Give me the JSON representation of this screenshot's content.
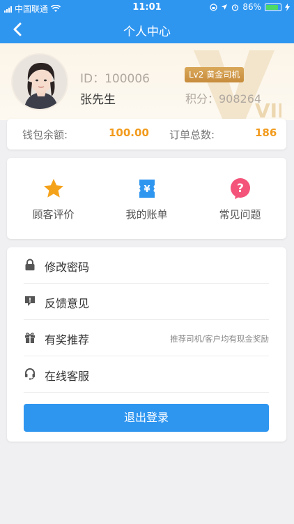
{
  "status_bar": {
    "carrier": "中国联通",
    "time": "11:01",
    "battery": "86%"
  },
  "nav": {
    "title": "个人中心"
  },
  "profile": {
    "id_text": "ID：100006",
    "name": "张先生",
    "level_badge": "Lv2 黄金司机",
    "points_text": "积分：908264",
    "vip_text": "VIP"
  },
  "stats": {
    "wallet_label": "钱包余额:",
    "wallet_value": "100.00",
    "orders_label": "订单总数:",
    "orders_value": "186"
  },
  "quick_actions": [
    {
      "label": "顾客评价",
      "icon": "star-icon"
    },
    {
      "label": "我的账单",
      "icon": "bill-icon"
    },
    {
      "label": "常见问题",
      "icon": "question-icon"
    }
  ],
  "menu": [
    {
      "label": "修改密码",
      "icon": "lock-icon",
      "note": ""
    },
    {
      "label": "反馈意见",
      "icon": "feedback-icon",
      "note": ""
    },
    {
      "label": "有奖推荐",
      "icon": "gift-icon",
      "note": "推荐司机/客户均有现金奖励"
    },
    {
      "label": "在线客服",
      "icon": "headset-icon",
      "note": ""
    }
  ],
  "logout_label": "退出登录",
  "colors": {
    "primary": "#2f96f0",
    "accent": "#f29b1d",
    "star": "#f5a21b",
    "question": "#f4547a",
    "badge": "#d9a85a"
  }
}
